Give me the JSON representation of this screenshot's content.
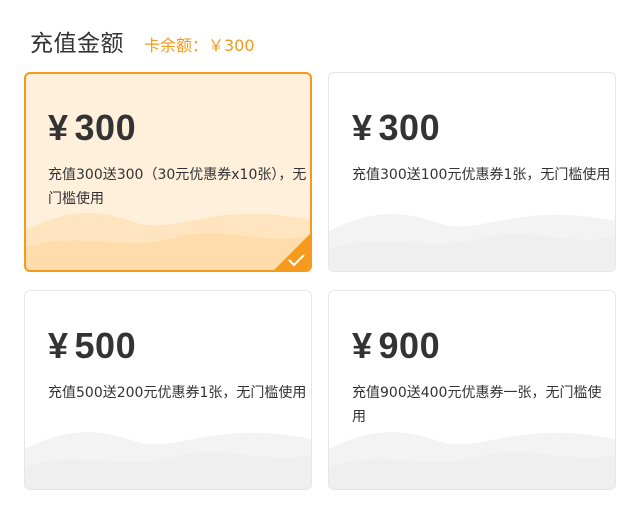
{
  "header": {
    "title": "充值金额",
    "balance_label": "卡余额：￥300"
  },
  "colors": {
    "accent": "#f59a1c",
    "selected_bg": "#fff0dc",
    "text": "#333333",
    "border": "#e6e6e6"
  },
  "cards": [
    {
      "yen": "¥",
      "amount": "300",
      "desc": "充值300送300（30元优惠券x10张），无门槛使用",
      "selected": true,
      "icon": "checkmark-icon"
    },
    {
      "yen": "¥",
      "amount": "300",
      "desc": "充值300送100元优惠券1张，无门槛使用",
      "selected": false
    },
    {
      "yen": "¥",
      "amount": "500",
      "desc": "充值500送200元优惠券1张，无门槛使用",
      "selected": false
    },
    {
      "yen": "¥",
      "amount": "900",
      "desc": "充值900送400元优惠券一张，无门槛使用",
      "selected": false
    }
  ]
}
